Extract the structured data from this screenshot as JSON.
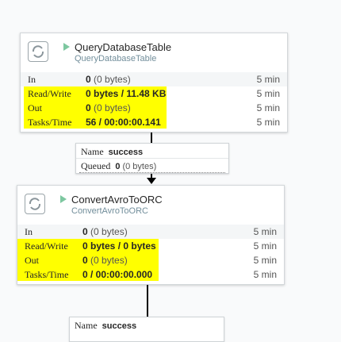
{
  "processors": [
    {
      "name": "QueryDatabaseTable",
      "type": "QueryDatabaseTable",
      "stats": [
        {
          "label": "In",
          "value": "0",
          "detail": "(0 bytes)",
          "time": "5 min"
        },
        {
          "label": "Read/Write",
          "value": "0 bytes / 11.48 KB",
          "detail": "",
          "time": "5 min"
        },
        {
          "label": "Out",
          "value": "0",
          "detail": "(0 bytes)",
          "time": "5 min"
        },
        {
          "label": "Tasks/Time",
          "value": "56 / 00:00:00.141",
          "detail": "",
          "time": "5 min"
        }
      ]
    },
    {
      "name": "ConvertAvroToORC",
      "type": "ConvertAvroToORC",
      "stats": [
        {
          "label": "In",
          "value": "0",
          "detail": "(0 bytes)",
          "time": "5 min"
        },
        {
          "label": "Read/Write",
          "value": "0 bytes / 0 bytes",
          "detail": "",
          "time": "5 min"
        },
        {
          "label": "Out",
          "value": "0",
          "detail": "(0 bytes)",
          "time": "5 min"
        },
        {
          "label": "Tasks/Time",
          "value": "0 / 00:00:00.000",
          "detail": "",
          "time": "5 min"
        }
      ]
    }
  ],
  "connections": [
    {
      "name_label": "Name",
      "name_value": "success",
      "queued_label": "Queued",
      "queued_value": "0",
      "queued_detail": "(0 bytes)"
    },
    {
      "name_label": "Name",
      "name_value": "success"
    }
  ],
  "colors": {
    "highlight": "#ffff00",
    "running": "#7dc7a0",
    "type_text": "#728e9b"
  },
  "icons": {
    "processor": "processor-icon",
    "run_state": "play-icon"
  }
}
